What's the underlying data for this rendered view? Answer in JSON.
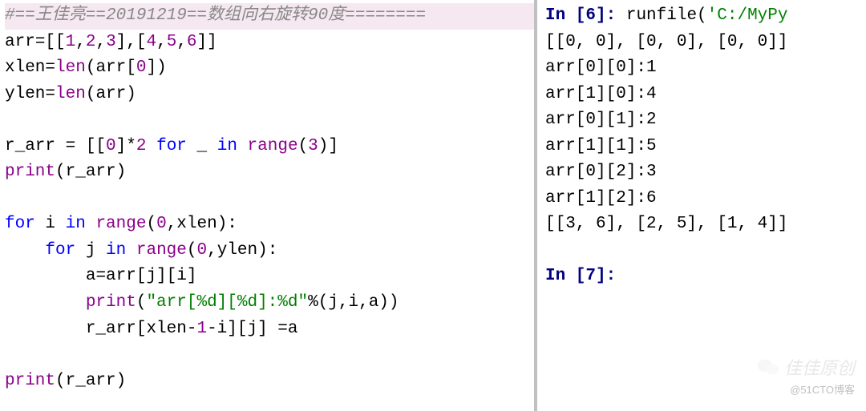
{
  "editor": {
    "lines": [
      {
        "type": "comment-highlight",
        "text": "#==王佳亮==20191219==数组向右旋转90度========"
      },
      {
        "type": "code",
        "segments": [
          {
            "t": "name",
            "v": "arr"
          },
          {
            "t": "op",
            "v": "=[["
          },
          {
            "t": "num",
            "v": "1"
          },
          {
            "t": "op",
            "v": ","
          },
          {
            "t": "num",
            "v": "2"
          },
          {
            "t": "op",
            "v": ","
          },
          {
            "t": "num",
            "v": "3"
          },
          {
            "t": "op",
            "v": "],["
          },
          {
            "t": "num",
            "v": "4"
          },
          {
            "t": "op",
            "v": ","
          },
          {
            "t": "num",
            "v": "5"
          },
          {
            "t": "op",
            "v": ","
          },
          {
            "t": "num",
            "v": "6"
          },
          {
            "t": "op",
            "v": "]]"
          }
        ]
      },
      {
        "type": "code",
        "segments": [
          {
            "t": "name",
            "v": "xlen"
          },
          {
            "t": "op",
            "v": "="
          },
          {
            "t": "builtin",
            "v": "len"
          },
          {
            "t": "op",
            "v": "(arr["
          },
          {
            "t": "num",
            "v": "0"
          },
          {
            "t": "op",
            "v": "])"
          }
        ]
      },
      {
        "type": "code",
        "segments": [
          {
            "t": "name",
            "v": "ylen"
          },
          {
            "t": "op",
            "v": "="
          },
          {
            "t": "builtin",
            "v": "len"
          },
          {
            "t": "op",
            "v": "(arr)"
          }
        ]
      },
      {
        "type": "blank"
      },
      {
        "type": "code",
        "segments": [
          {
            "t": "name",
            "v": "r_arr "
          },
          {
            "t": "op",
            "v": "= [["
          },
          {
            "t": "num",
            "v": "0"
          },
          {
            "t": "op",
            "v": "]*"
          },
          {
            "t": "num",
            "v": "2"
          },
          {
            "t": "op",
            "v": " "
          },
          {
            "t": "kw",
            "v": "for"
          },
          {
            "t": "op",
            "v": " _ "
          },
          {
            "t": "kw",
            "v": "in"
          },
          {
            "t": "op",
            "v": " "
          },
          {
            "t": "builtin",
            "v": "range"
          },
          {
            "t": "op",
            "v": "("
          },
          {
            "t": "num",
            "v": "3"
          },
          {
            "t": "op",
            "v": ")]"
          }
        ]
      },
      {
        "type": "code",
        "segments": [
          {
            "t": "builtin",
            "v": "print"
          },
          {
            "t": "op",
            "v": "(r_arr)"
          }
        ]
      },
      {
        "type": "blank"
      },
      {
        "type": "code",
        "segments": [
          {
            "t": "kw",
            "v": "for"
          },
          {
            "t": "name",
            "v": " i "
          },
          {
            "t": "kw",
            "v": "in"
          },
          {
            "t": "op",
            "v": " "
          },
          {
            "t": "builtin",
            "v": "range"
          },
          {
            "t": "op",
            "v": "("
          },
          {
            "t": "num",
            "v": "0"
          },
          {
            "t": "op",
            "v": ",xlen):"
          }
        ]
      },
      {
        "type": "code",
        "indent": 1,
        "segments": [
          {
            "t": "kw",
            "v": "for"
          },
          {
            "t": "name",
            "v": " j "
          },
          {
            "t": "kw",
            "v": "in"
          },
          {
            "t": "op",
            "v": " "
          },
          {
            "t": "builtin",
            "v": "range"
          },
          {
            "t": "op",
            "v": "("
          },
          {
            "t": "num",
            "v": "0"
          },
          {
            "t": "op",
            "v": ",ylen):"
          }
        ]
      },
      {
        "type": "code",
        "indent": 2,
        "segments": [
          {
            "t": "name",
            "v": "a"
          },
          {
            "t": "op",
            "v": "=arr[j][i]"
          }
        ]
      },
      {
        "type": "code",
        "indent": 2,
        "segments": [
          {
            "t": "builtin",
            "v": "print"
          },
          {
            "t": "op",
            "v": "("
          },
          {
            "t": "str",
            "v": "\"arr[%d][%d]:%d\""
          },
          {
            "t": "op",
            "v": "%(j,i,a))"
          }
        ]
      },
      {
        "type": "code",
        "indent": 2,
        "segments": [
          {
            "t": "name",
            "v": "r_arr"
          },
          {
            "t": "op",
            "v": "[xlen-"
          },
          {
            "t": "num",
            "v": "1"
          },
          {
            "t": "op",
            "v": "-i][j] =a"
          }
        ]
      },
      {
        "type": "blank"
      },
      {
        "type": "code",
        "segments": [
          {
            "t": "builtin",
            "v": "print"
          },
          {
            "t": "op",
            "v": "(r_arr)"
          }
        ]
      }
    ]
  },
  "console": {
    "lines": [
      {
        "type": "prompt",
        "promptLabel": "In [",
        "promptNum": "6",
        "promptClose": "]: ",
        "segments": [
          {
            "t": "name",
            "v": "runfile("
          },
          {
            "t": "console-str",
            "v": "'C:/MyPy"
          }
        ]
      },
      {
        "type": "output",
        "text": "[[0, 0], [0, 0], [0, 0]]"
      },
      {
        "type": "output",
        "text": "arr[0][0]:1"
      },
      {
        "type": "output",
        "text": "arr[1][0]:4"
      },
      {
        "type": "output",
        "text": "arr[0][1]:2"
      },
      {
        "type": "output",
        "text": "arr[1][1]:5"
      },
      {
        "type": "output",
        "text": "arr[0][2]:3"
      },
      {
        "type": "output",
        "text": "arr[1][2]:6"
      },
      {
        "type": "output",
        "text": "[[3, 6], [2, 5], [1, 4]]"
      },
      {
        "type": "blank"
      },
      {
        "type": "prompt",
        "promptLabel": "In [",
        "promptNum": "7",
        "promptClose": "]: ",
        "segments": []
      }
    ]
  },
  "watermark": {
    "top": "佳佳原创",
    "bottom": "@51CTO博客"
  }
}
